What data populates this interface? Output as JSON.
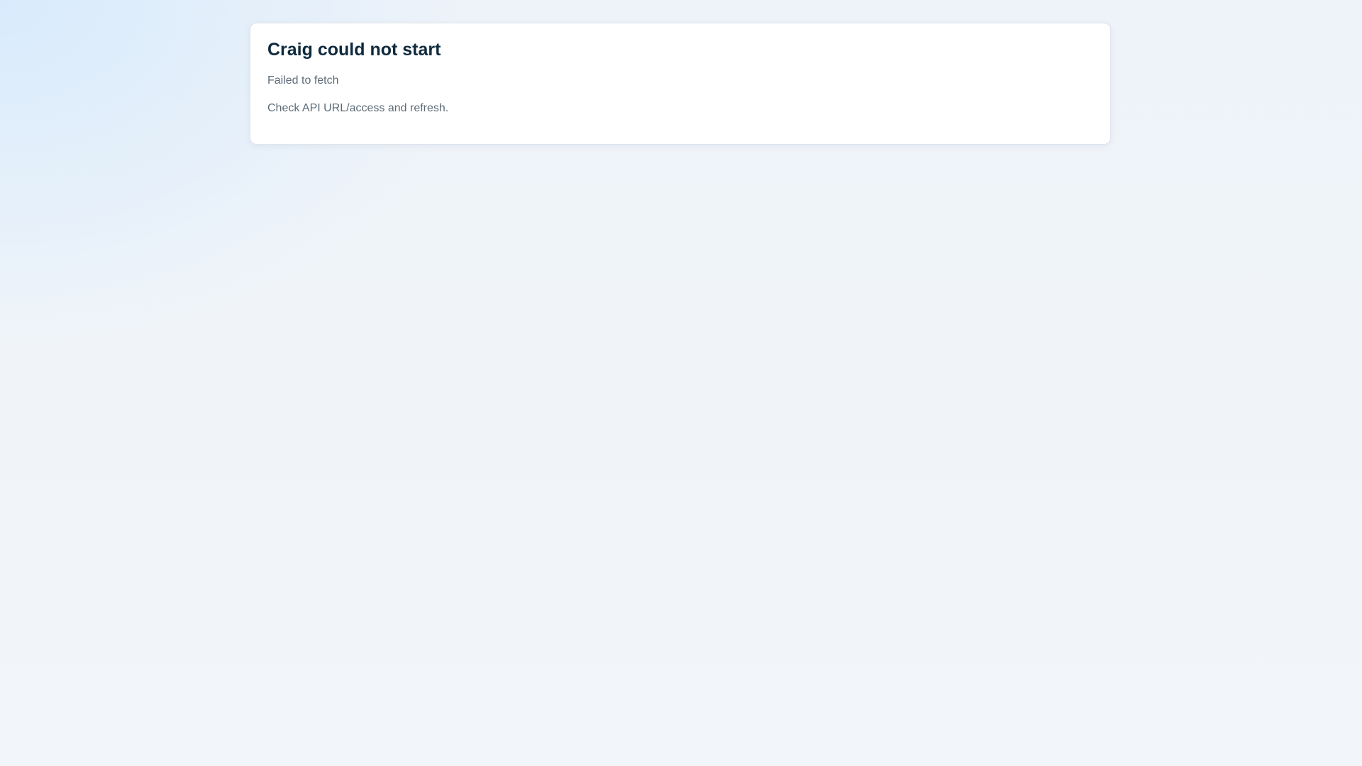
{
  "error_card": {
    "title": "Craig could not start",
    "error_message": "Failed to fetch",
    "hint": "Check API URL/access and refresh."
  },
  "colors": {
    "title": "#0f2a3d",
    "body_text": "#5c6b78",
    "card_background": "#ffffff",
    "page_background": "#eef3f9"
  }
}
